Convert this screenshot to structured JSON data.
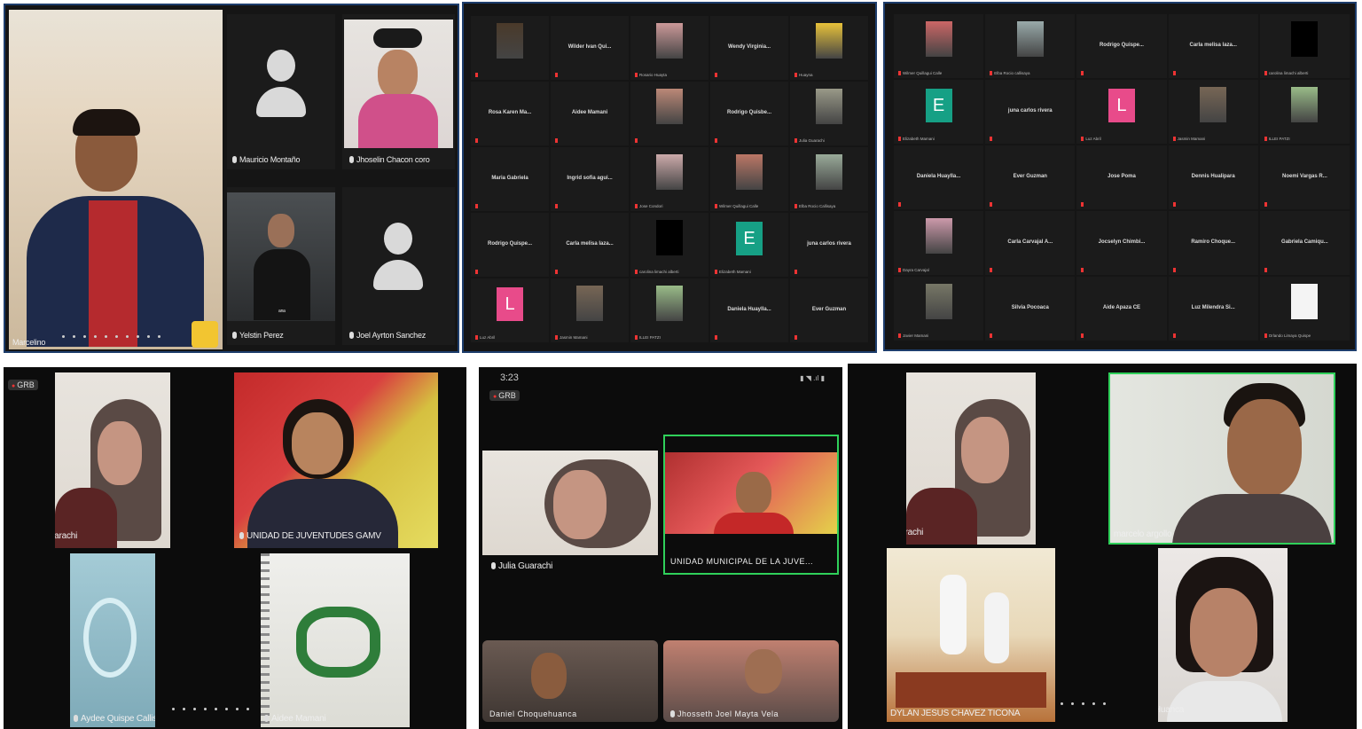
{
  "screen1": {
    "participants": {
      "marcelino": "Marcelino",
      "mauricio": "Mauricio Montaño",
      "jhoselin": "Jhoselin Chacon coro",
      "yelstin": "Yelstin Perez",
      "joel": "Joel Ayrton Sanchez",
      "small_tag": "ana"
    }
  },
  "screen2": {
    "cells": [
      {
        "name": "",
        "sub": "",
        "kind": "img",
        "color": "#4a3a2a"
      },
      {
        "name": "Wilder Ivan Qui...",
        "sub": ""
      },
      {
        "name": "",
        "sub": "Rosario Huayta",
        "kind": "img",
        "color": "#c99"
      },
      {
        "name": "Wendy Virginia...",
        "sub": ""
      },
      {
        "name": "",
        "sub": "Huayna",
        "kind": "img",
        "color": "#e8c23a"
      },
      {
        "name": "Rosa Karen Ma...",
        "sub": ""
      },
      {
        "name": "Aidee Mamani",
        "sub": ""
      },
      {
        "name": "",
        "sub": "",
        "kind": "img",
        "color": "#b87"
      },
      {
        "name": "Rodrigo Quisbe...",
        "sub": ""
      },
      {
        "name": "",
        "sub": "Julia Guarachi",
        "kind": "img",
        "color": "#998"
      },
      {
        "name": "Maria Gabriela",
        "sub": ""
      },
      {
        "name": "Ingrid sofia agui...",
        "sub": ""
      },
      {
        "name": "",
        "sub": "Jose Condori",
        "kind": "img",
        "color": "#caa"
      },
      {
        "name": "",
        "sub": "Wilmer Quillagui Calle",
        "kind": "img",
        "color": "#b76"
      },
      {
        "name": "",
        "sub": "Elba Rocio Callisaya",
        "kind": "img",
        "color": "#9a9"
      },
      {
        "name": "Rodrigo Quispe...",
        "sub": ""
      },
      {
        "name": "Carla melisa laza...",
        "sub": ""
      },
      {
        "name": "",
        "sub": "carolina limachi alberti",
        "kind": "black"
      },
      {
        "name": "",
        "sub": "Elizabeth Mamani",
        "kind": "letter",
        "letter": "E",
        "color": "#16a085"
      },
      {
        "name": "juna carlos rivera",
        "sub": ""
      },
      {
        "name": "",
        "sub": "Luz Abril",
        "kind": "letter",
        "letter": "L",
        "color": "#e84b8a"
      },
      {
        "name": "",
        "sub": "Jasmin Mamani",
        "kind": "img",
        "color": "#765"
      },
      {
        "name": "",
        "sub": "ILLEI PATZI",
        "kind": "img",
        "color": "#9b8"
      },
      {
        "name": "Daniela Huaylla...",
        "sub": ""
      },
      {
        "name": "Ever Guzman",
        "sub": ""
      }
    ]
  },
  "screen3": {
    "cells": [
      {
        "name": "",
        "sub": "Wilmer Quillagui Calle",
        "kind": "img",
        "color": "#c66"
      },
      {
        "name": "",
        "sub": "Elba Rocio callisaya",
        "kind": "img",
        "color": "#9aa"
      },
      {
        "name": "Rodrigo Quispe...",
        "sub": ""
      },
      {
        "name": "Carla melisa laza...",
        "sub": ""
      },
      {
        "name": "",
        "sub": "carolina limachi alberti",
        "kind": "black"
      },
      {
        "name": "",
        "sub": "Elizabeth Mamani",
        "kind": "letter",
        "letter": "E",
        "color": "#16a085"
      },
      {
        "name": "juna carlos rivera",
        "sub": ""
      },
      {
        "name": "",
        "sub": "Luz Abril",
        "kind": "letter",
        "letter": "L",
        "color": "#e84b8a"
      },
      {
        "name": "",
        "sub": "Jasmin Mamani",
        "kind": "img",
        "color": "#765"
      },
      {
        "name": "",
        "sub": "ILLEI PATZI",
        "kind": "img",
        "color": "#9b8"
      },
      {
        "name": "Daniela Huaylla...",
        "sub": ""
      },
      {
        "name": "Ever Guzman",
        "sub": ""
      },
      {
        "name": "Jose Poma",
        "sub": ""
      },
      {
        "name": "Dennis Hualipara",
        "sub": ""
      },
      {
        "name": "Noemi Vargas R...",
        "sub": ""
      },
      {
        "name": "",
        "sub": "Dayra Carvajal",
        "kind": "img",
        "color": "#c9a"
      },
      {
        "name": "Carla Carvajal A...",
        "sub": ""
      },
      {
        "name": "Jocselyn Chimbi...",
        "sub": ""
      },
      {
        "name": "Ramiro Choque...",
        "sub": ""
      },
      {
        "name": "Gabriela Camiqu...",
        "sub": ""
      },
      {
        "name": "",
        "sub": "Javier Mamani",
        "kind": "img",
        "color": "#776"
      },
      {
        "name": "Silvia Pocoaca",
        "sub": ""
      },
      {
        "name": "Aide Apaza CE",
        "sub": ""
      },
      {
        "name": "Luz Milendra Si...",
        "sub": ""
      },
      {
        "name": "",
        "sub": "Orlando Limaya Quispe",
        "kind": "white"
      }
    ]
  },
  "screen4": {
    "rec": "GRB",
    "julia": "Julia Guarachi",
    "unidad": "UNIDAD DE JUVENTUDES GAMV",
    "aydee": "Aydee Quispe Callisaya",
    "aidee": "Aidee Mamani"
  },
  "screen5": {
    "time": "3:23",
    "rec": "GRB",
    "julia": "Julia Guarachi",
    "unidad": "UNIDAD MUNICIPAL DE LA JUVE...",
    "daniel": "Daniel Choquehuanca",
    "jhosseth": "Jhosseth Joel Mayta Vela"
  },
  "screen6": {
    "julia": "Julia Guarachi",
    "marcelo": "marcelo argollo",
    "dylan": "DYLAN JESUS CHAVEZ TICONA",
    "ada": "Ada Luz Huanca"
  },
  "colors": {
    "accent_green": "#2fd05a",
    "avatar_gray": "#d9d9d9",
    "frame_border": "#1d4f8c"
  }
}
